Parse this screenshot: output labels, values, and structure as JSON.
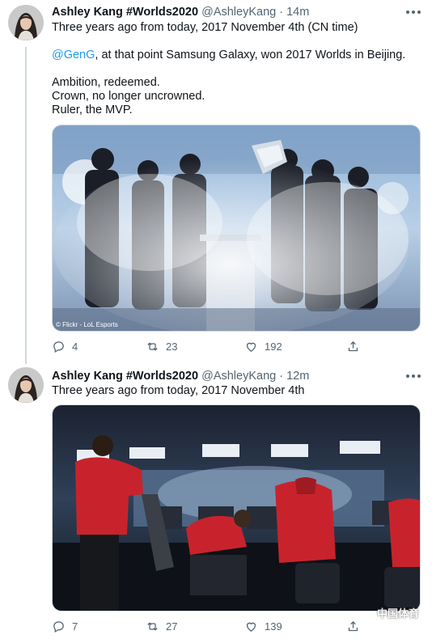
{
  "tweets": [
    {
      "author_name": "Ashley Kang #Worlds2020",
      "handle": "@AshleyKang",
      "separator": "·",
      "time": "14m",
      "lines": [
        "Three years ago from today, 2017 November 4th (CN time)",
        "",
        "@GenG, at that point Samsung Galaxy, won 2017 Worlds in Beijing.",
        "",
        "Ambition, redeemed.",
        "Crown, no longer uncrowned.",
        "Ruler, the MVP."
      ],
      "mention": "@GenG",
      "line3_rest": ", at that point Samsung Galaxy, won 2017 Worlds in Beijing.",
      "image_credit": "© Flickr - LoL Esports",
      "replies": "4",
      "retweets": "23",
      "likes": "192"
    },
    {
      "author_name": "Ashley Kang #Worlds2020",
      "handle": "@AshleyKang",
      "separator": "·",
      "time": "12m",
      "line1": "Three years ago from today, 2017 November 4th",
      "replies": "7",
      "retweets": "27",
      "likes": "139",
      "watermark": "中国体育"
    }
  ],
  "icons": {
    "more": "more-icon",
    "reply": "reply-icon",
    "retweet": "retweet-icon",
    "like": "like-icon",
    "share": "share-icon"
  },
  "colors": {
    "text": "#0f1419",
    "secondary": "#536471",
    "link": "#1d9bf0",
    "border": "#cfd9de"
  }
}
